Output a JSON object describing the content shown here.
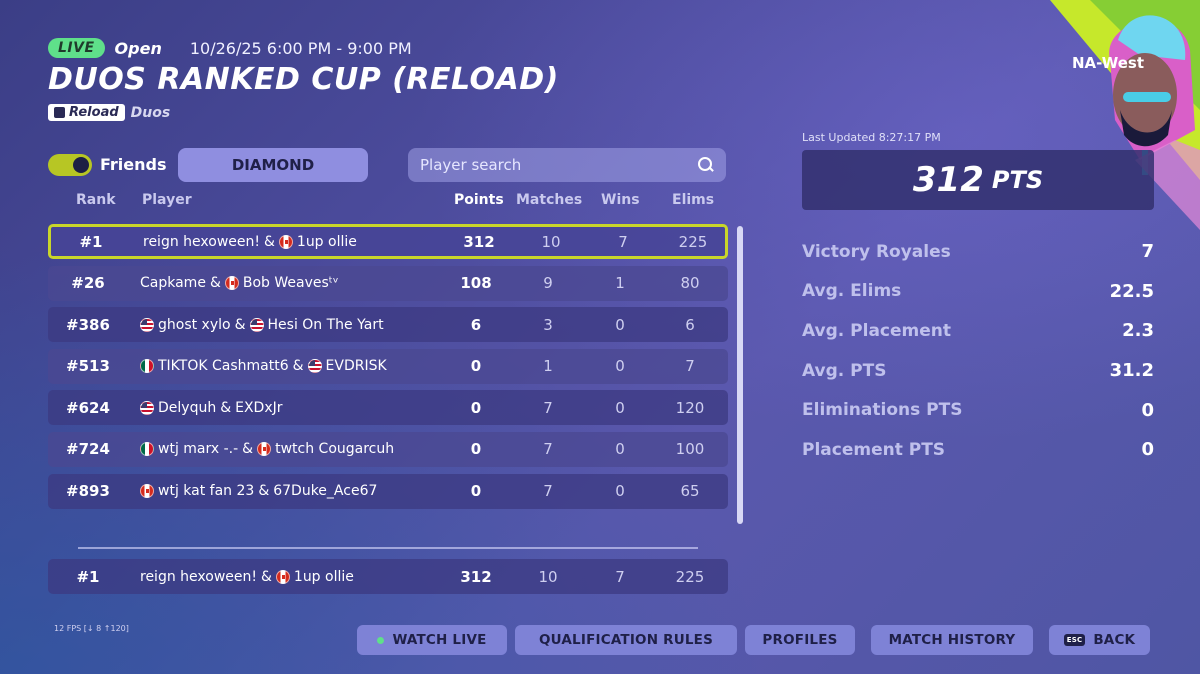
{
  "header": {
    "live_badge": "LIVE",
    "status": "Open",
    "time_range": "10/26/25 6:00 PM - 9:00 PM",
    "title": "DUOS RANKED CUP (RELOAD)",
    "mode_chip": "Reload",
    "mode_sub": "Duos"
  },
  "filters": {
    "friends_label": "Friends",
    "friends_enabled": true,
    "rank_tier": "DIAMOND",
    "search_placeholder": "Player search"
  },
  "columns": {
    "rank": "Rank",
    "player": "Player",
    "points": "Points",
    "matches": "Matches",
    "wins": "Wins",
    "elims": "Elims"
  },
  "rows": [
    {
      "rank": "#1",
      "p1": "reign hexoween!",
      "sep": "&",
      "p2": "1up ollie",
      "f1": "",
      "f2": "ca",
      "points": "312",
      "matches": "10",
      "wins": "7",
      "elims": "225"
    },
    {
      "rank": "#26",
      "p1": "Capkame",
      "sep": "&",
      "p2": "Bob Weavesᵗᵛ",
      "f1": "",
      "f2": "ca",
      "points": "108",
      "matches": "9",
      "wins": "1",
      "elims": "80"
    },
    {
      "rank": "#386",
      "p1": "ghost xylo",
      "sep": "&",
      "p2": "Hesi On The Yart",
      "f1": "us",
      "f2": "us",
      "points": "6",
      "matches": "3",
      "wins": "0",
      "elims": "6"
    },
    {
      "rank": "#513",
      "p1": "TIKTOK Cashmatt6",
      "sep": "&",
      "p2": "EVDRISK",
      "f1": "mx",
      "f2": "us",
      "points": "0",
      "matches": "1",
      "wins": "0",
      "elims": "7"
    },
    {
      "rank": "#624",
      "p1": "Delyquh",
      "sep": "&",
      "p2": "EXDxJr",
      "f1": "us",
      "f2": "",
      "points": "0",
      "matches": "7",
      "wins": "0",
      "elims": "120"
    },
    {
      "rank": "#724",
      "p1": "wtj marx -.-",
      "sep": "&",
      "p2": "twtch Cougarcuh",
      "f1": "mx",
      "f2": "ca",
      "points": "0",
      "matches": "7",
      "wins": "0",
      "elims": "100"
    },
    {
      "rank": "#893",
      "p1": "wtj kat fan 23",
      "sep": "&",
      "p2": "67Duke_Ace67",
      "f1": "ca",
      "f2": "",
      "points": "0",
      "matches": "7",
      "wins": "0",
      "elims": "65"
    }
  ],
  "scroll_fraction_visible": 1.0,
  "my_row": {
    "rank": "#1",
    "p1": "reign hexoween!",
    "sep": "&",
    "p2": "1up ollie",
    "f1": "",
    "f2": "ca",
    "points": "312",
    "matches": "10",
    "wins": "7",
    "elims": "225"
  },
  "summary": {
    "region": "NA-West",
    "last_updated": "Last Updated 8:27:17 PM",
    "points_value": "312",
    "points_unit": "PTS",
    "stats": [
      {
        "label": "Victory Royales",
        "value": "7"
      },
      {
        "label": "Avg. Elims",
        "value": "22.5"
      },
      {
        "label": "Avg. Placement",
        "value": "2.3"
      },
      {
        "label": "Avg. PTS",
        "value": "31.2"
      },
      {
        "label": "Eliminations PTS",
        "value": "0"
      },
      {
        "label": "Placement PTS",
        "value": "0"
      }
    ]
  },
  "fps_readout": "12 FPS [↓ 8 ↑120]",
  "buttons": {
    "watch_live": "WATCH LIVE",
    "qualification_rules": "QUALIFICATION RULES",
    "profiles": "PROFILES",
    "match_history": "MATCH HISTORY",
    "esc_key": "ESC",
    "back": "BACK"
  },
  "colors": {
    "accent_live": "#5fe08a",
    "selection_outline": "#c9d62a",
    "button_bg": "#7e82d6"
  },
  "icons": {
    "search": "magnifier-icon",
    "mode": "reload-shield-icon",
    "live_dot": "live-dot-icon"
  }
}
